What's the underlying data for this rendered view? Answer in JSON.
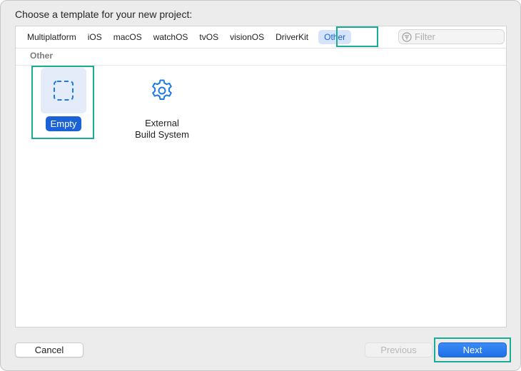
{
  "dialog": {
    "prompt": "Choose a template for your new project:"
  },
  "tabs": [
    {
      "label": "Multiplatform",
      "active": false
    },
    {
      "label": "iOS",
      "active": false
    },
    {
      "label": "macOS",
      "active": false
    },
    {
      "label": "watchOS",
      "active": false
    },
    {
      "label": "tvOS",
      "active": false
    },
    {
      "label": "visionOS",
      "active": false
    },
    {
      "label": "DriverKit",
      "active": false
    },
    {
      "label": "Other",
      "active": true
    }
  ],
  "filter": {
    "placeholder": "Filter",
    "value": "",
    "icon": "filter-icon"
  },
  "section": {
    "title": "Other"
  },
  "templates": [
    {
      "label": "Empty",
      "icon": "dashed-square-icon",
      "selected": true
    },
    {
      "label_line1": "External",
      "label_line2": "Build System",
      "icon": "gear-icon",
      "selected": false
    }
  ],
  "buttons": {
    "cancel": "Cancel",
    "previous": "Previous",
    "next": "Next"
  },
  "colors": {
    "accent": "#1a62d6",
    "highlight": "#1aad96",
    "selected_tile_bg": "#e3ecf8"
  }
}
